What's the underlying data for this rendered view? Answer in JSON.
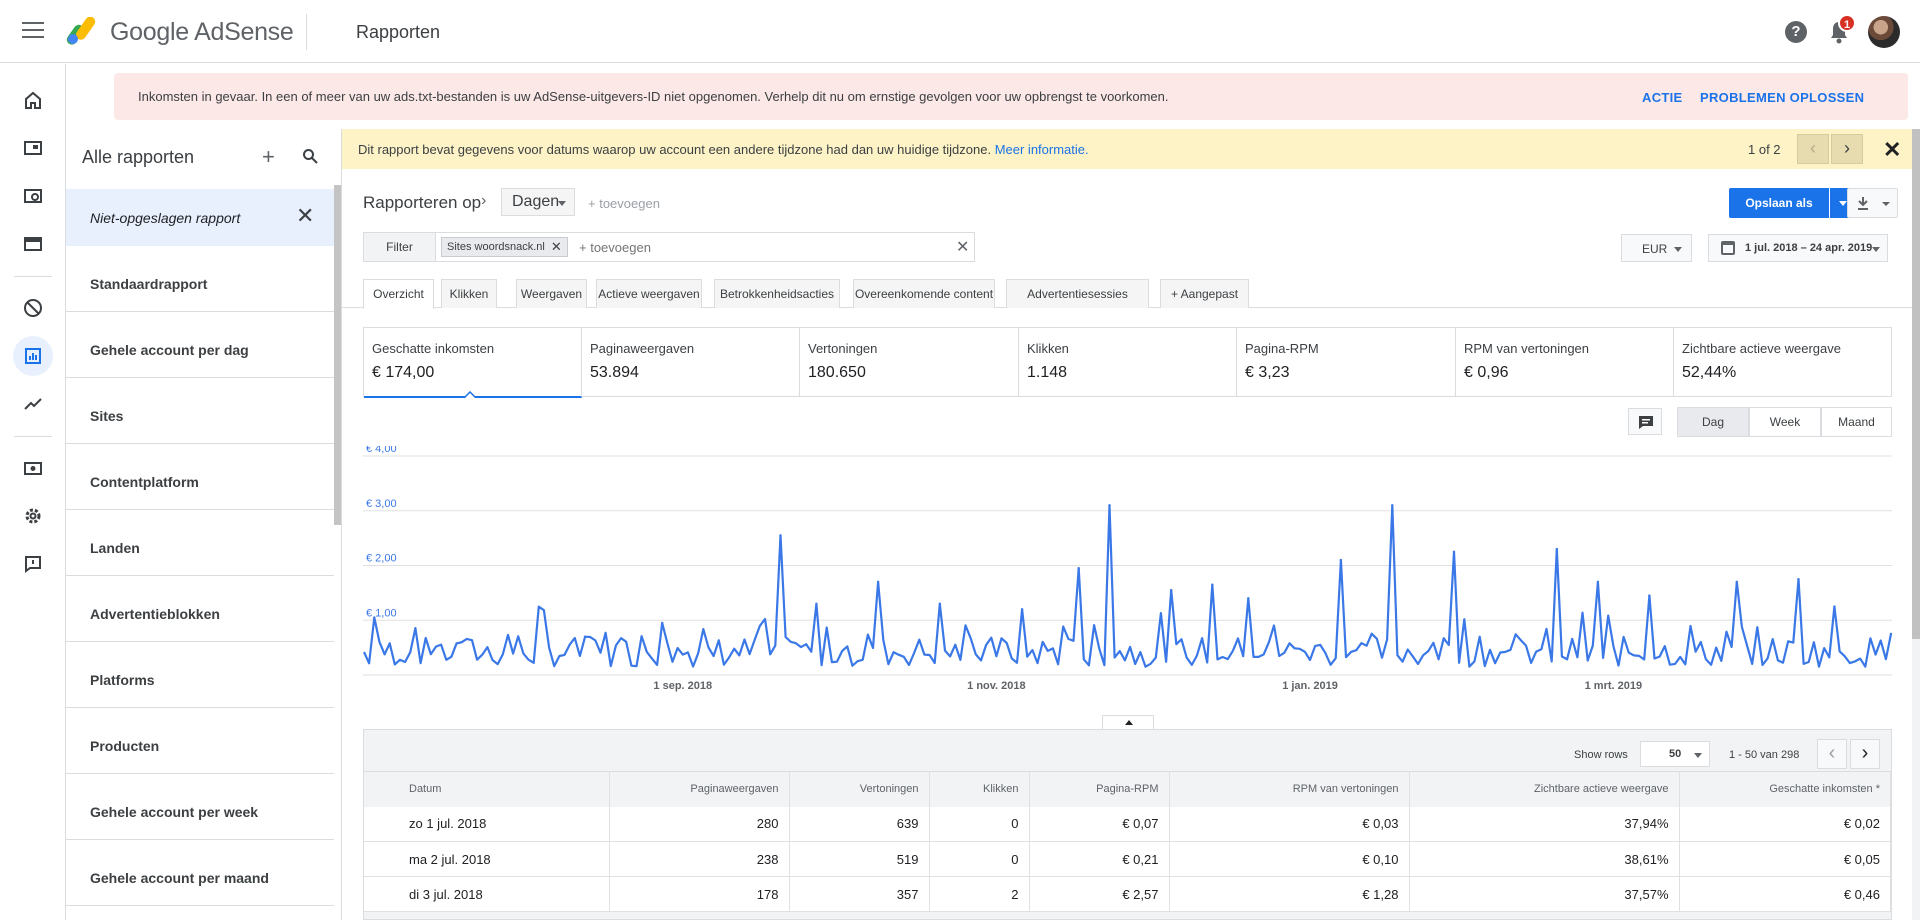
{
  "topbar": {
    "brand_google": "Google",
    "brand_product": "AdSense",
    "page_title": "Rapporten",
    "notification_count": "1",
    "help_glyph": "?"
  },
  "icons": {
    "menu": "menu-icon",
    "help": "help-icon",
    "bell": "notifications-icon",
    "avatar": "account-avatar",
    "rail": [
      "home-icon",
      "ads-icon",
      "page-search-icon",
      "sites-icon",
      "block-icon",
      "reports-icon",
      "optimization-icon",
      "payments-icon",
      "settings-icon",
      "feedback-icon"
    ]
  },
  "alert": {
    "text": "Inkomsten in gevaar. In een of meer van uw ads.txt-bestanden is uw AdSense-uitgevers-ID niet opgenomen. Verhelp dit nu om ernstige gevolgen voor uw opbrengst te voorkomen.",
    "action": "ACTIE",
    "fix": "PROBLEMEN OPLOSSEN"
  },
  "sidebar": {
    "title": "Alle rapporten",
    "plus_glyph": "+",
    "close_glyph": "✕",
    "unsaved": "Niet-opgeslagen rapport",
    "items": [
      {
        "label": "Standaardrapport"
      },
      {
        "label": "Gehele account per dag"
      },
      {
        "label": "Sites"
      },
      {
        "label": "Contentplatform"
      },
      {
        "label": "Landen"
      },
      {
        "label": "Advertentieblokken"
      },
      {
        "label": "Platforms"
      },
      {
        "label": "Producten"
      },
      {
        "label": "Gehele account per week"
      },
      {
        "label": "Gehele account per maand"
      }
    ]
  },
  "info_banner": {
    "text": "Dit rapport bevat gegevens voor datums waarop uw account een andere tijdzone had dan uw huidige tijdzone.",
    "link": "Meer informatie.",
    "count": "1 of 2",
    "prev_glyph": "‹",
    "next_glyph": "›",
    "close_glyph": "✕"
  },
  "builder": {
    "label": "Rapporteren op",
    "chevron_glyph": "›",
    "dimension": "Dagen",
    "add": "+ toevoegen",
    "save": "Opslaan als",
    "filter_label": "Filter",
    "filter_chip": "Sites woordsnack.nl",
    "filter_placeholder": "+ toevoegen",
    "chip_remove_glyph": "✕",
    "clear_glyph": "✕",
    "currency": "EUR",
    "date_range": "1 jul. 2018 – 24 apr. 2019"
  },
  "tabs": [
    "Overzicht",
    "Klikken",
    "Weergaven",
    "Actieve weergaven",
    "Betrokkenheidsacties",
    "Overeenkomende content",
    "Advertentiesessies",
    "+  Aangepast"
  ],
  "metrics": [
    {
      "name": "Geschatte inkomsten",
      "value": "€ 174,00"
    },
    {
      "name": "Paginaweergaven",
      "value": "53.894"
    },
    {
      "name": "Vertoningen",
      "value": "180.650"
    },
    {
      "name": "Klikken",
      "value": "1.148"
    },
    {
      "name": "Pagina-RPM",
      "value": "€ 3,23"
    },
    {
      "name": "RPM van vertoningen",
      "value": "€ 0,96"
    },
    {
      "name": "Zichtbare actieve weergave",
      "value": "52,44%"
    }
  ],
  "granularity": [
    "Dag",
    "Week",
    "Maand"
  ],
  "chart_data": {
    "type": "line",
    "series_color": "#3b78e7",
    "ylim": [
      0,
      4
    ],
    "y_ticks": [
      "€ 4,00",
      "€ 3,00",
      "€ 2,00",
      "€ 1,00"
    ],
    "x_ticks": [
      "1 sep. 2018",
      "1 nov. 2018",
      "1 jan. 2019",
      "1 mrt. 2019"
    ],
    "x_start": "2018-07-01",
    "x_end": "2019-04-24",
    "peaks": [
      {
        "date": "2018-07-03",
        "value": 1.05
      },
      {
        "date": "2018-07-20",
        "value": 0.6
      },
      {
        "date": "2018-08-13",
        "value": 0.7
      },
      {
        "date": "2018-08-28",
        "value": 0.95
      },
      {
        "date": "2018-09-20",
        "value": 2.55
      },
      {
        "date": "2018-09-27",
        "value": 1.3
      },
      {
        "date": "2018-10-09",
        "value": 1.7
      },
      {
        "date": "2018-10-21",
        "value": 1.3
      },
      {
        "date": "2018-11-06",
        "value": 1.2
      },
      {
        "date": "2018-11-17",
        "value": 1.95
      },
      {
        "date": "2018-11-23",
        "value": 3.1
      },
      {
        "date": "2018-12-05",
        "value": 1.55
      },
      {
        "date": "2018-12-13",
        "value": 1.65
      },
      {
        "date": "2018-12-20",
        "value": 1.4
      },
      {
        "date": "2019-01-07",
        "value": 2.1
      },
      {
        "date": "2019-01-17",
        "value": 3.1
      },
      {
        "date": "2019-01-29",
        "value": 2.25
      },
      {
        "date": "2019-02-18",
        "value": 2.3
      },
      {
        "date": "2019-02-26",
        "value": 1.7
      },
      {
        "date": "2019-03-08",
        "value": 1.45
      },
      {
        "date": "2019-03-25",
        "value": 1.7
      },
      {
        "date": "2019-04-06",
        "value": 1.75
      },
      {
        "date": "2019-04-13",
        "value": 1.25
      },
      {
        "date": "2019-04-24",
        "value": 0.75
      }
    ]
  },
  "table": {
    "show_rows_label": "Show rows",
    "rows": "50",
    "range": "1 - 50 van 298",
    "headers": [
      "Datum",
      "Paginaweergaven",
      "Vertoningen",
      "Klikken",
      "Pagina-RPM",
      "RPM van vertoningen",
      "Zichtbare actieve weergave",
      "Geschatte inkomsten *"
    ],
    "data": [
      [
        "zo 1 jul. 2018",
        "280",
        "639",
        "0",
        "€ 0,07",
        "€ 0,03",
        "37,94%",
        "€ 0,02"
      ],
      [
        "ma 2 jul. 2018",
        "238",
        "519",
        "0",
        "€ 0,21",
        "€ 0,10",
        "38,61%",
        "€ 0,05"
      ],
      [
        "di 3 jul. 2018",
        "178",
        "357",
        "2",
        "€ 2,57",
        "€ 1,28",
        "37,57%",
        "€ 0,46"
      ]
    ]
  }
}
